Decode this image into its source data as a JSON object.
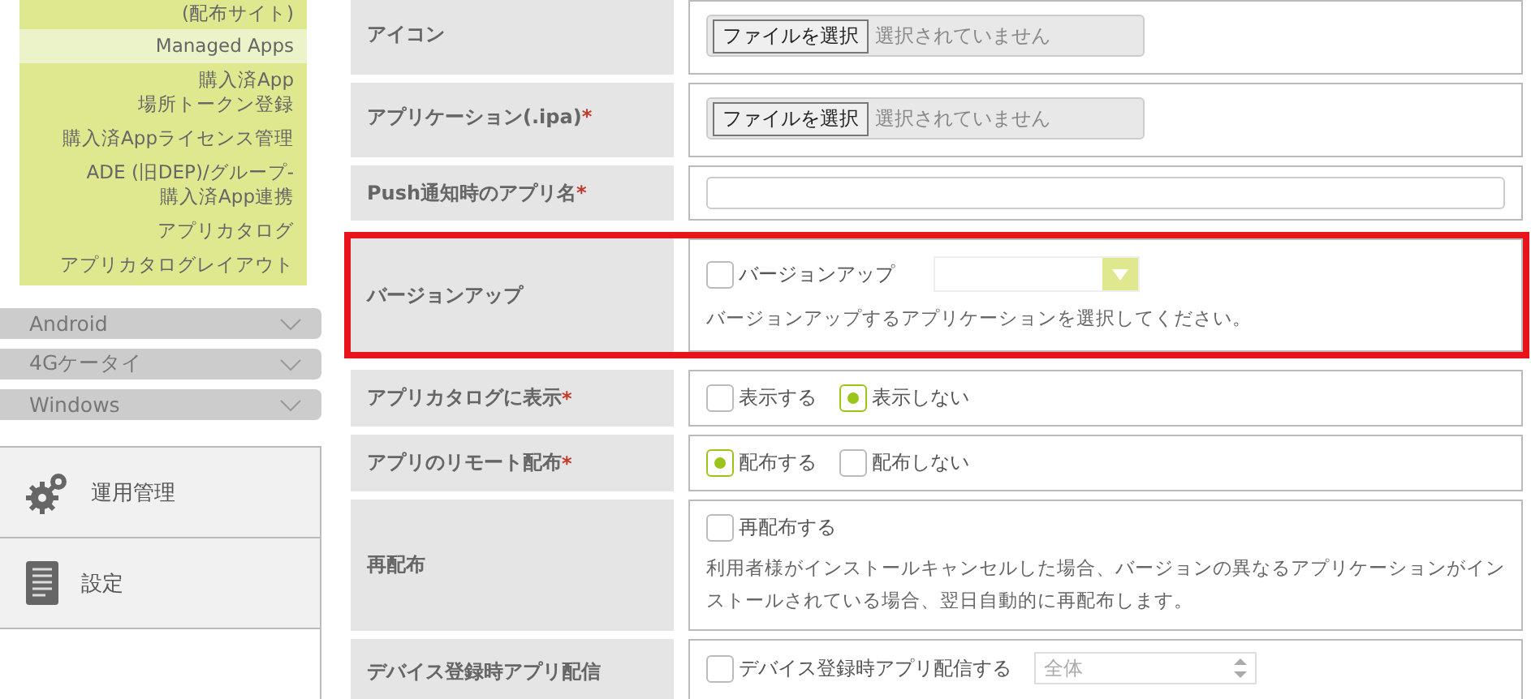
{
  "sidebar": {
    "menu_items": [
      {
        "label": "(配布サイト)",
        "selected": false
      },
      {
        "label": "Managed Apps",
        "selected": true
      },
      {
        "label": "購入済App\n場所トークン登録",
        "selected": false
      },
      {
        "label": "購入済Appライセンス管理",
        "selected": false
      },
      {
        "label": "ADE (旧DEP)/グループ-\n購入済App連携",
        "selected": false
      },
      {
        "label": "アプリカタログ",
        "selected": false
      },
      {
        "label": "アプリカタログレイアウト",
        "selected": false
      }
    ],
    "sections": [
      {
        "label": "Android",
        "expanded": false
      },
      {
        "label": "4Gケータイ",
        "expanded": false
      },
      {
        "label": "Windows",
        "expanded": false
      }
    ],
    "nav": [
      {
        "label": "運用管理",
        "kind": "gear"
      },
      {
        "label": "設定",
        "kind": "document"
      }
    ]
  },
  "form": [
    {
      "label": "アイコン",
      "kind": "file",
      "button": "ファイルを選択",
      "status": "選択されていません",
      "highlighted": false
    },
    {
      "label": "アプリケーション(.ipa)",
      "required_mark": "*",
      "kind": "file",
      "button": "ファイルを選択",
      "status": "選択されていません",
      "highlighted": false
    },
    {
      "label": "Push通知時のアプリ名",
      "required_mark": "*",
      "kind": "text",
      "highlighted": false
    },
    {
      "label": "バージョンアップ",
      "kind": "checkbox_dropdown",
      "checkbox": {
        "label": "バージョンアップ",
        "checked": false
      },
      "note": "バージョンアップするアプリケーションを選択してください。",
      "highlighted": true
    },
    {
      "label": "アプリカタログに表示",
      "required_mark": "*",
      "kind": "radio",
      "options": [
        {
          "label": "表示する",
          "selected": false
        },
        {
          "label": "表示しない",
          "selected": true
        }
      ],
      "highlighted": false
    },
    {
      "label": "アプリのリモート配布",
      "required_mark": "*",
      "kind": "radio",
      "options": [
        {
          "label": "配布する",
          "selected": true
        },
        {
          "label": "配布しない",
          "selected": false
        }
      ],
      "highlighted": false
    },
    {
      "label": "再配布",
      "kind": "checkbox_note",
      "checkbox": {
        "label": "再配布する",
        "checked": false
      },
      "note": "利用者様がインストールキャンセルした場合、バージョンの異なるアプリケーションがインストールされている場合、翌日自動的に再配布します。",
      "highlighted": false
    },
    {
      "label": "デバイス登録時アプリ配信",
      "kind": "checkbox_spinner",
      "checkbox": {
        "label": "デバイス登録時アプリ配信する",
        "checked": false
      },
      "spinner": "全体",
      "highlighted": false
    }
  ]
}
